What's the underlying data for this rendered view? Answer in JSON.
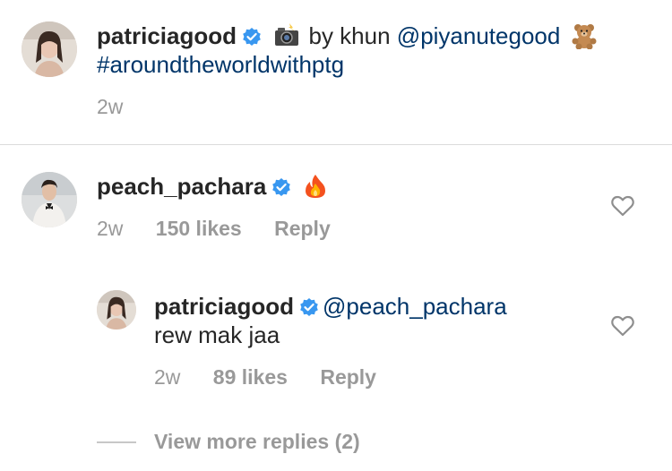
{
  "caption": {
    "username": "patriciagood",
    "camera_emoji": "camera-with-flash",
    "by_text": "by khun",
    "mention": "@piyanutegood",
    "bear_emoji": "teddy-bear",
    "hashtag": "#aroundtheworldwithptg",
    "time": "2w"
  },
  "comment": {
    "username": "peach_pachara",
    "emoji": "fire",
    "time": "2w",
    "likes": "150 likes",
    "reply_label": "Reply"
  },
  "reply": {
    "username": "patriciagood",
    "mention": "@peach_pachara",
    "text": "rew mak jaa",
    "time": "2w",
    "likes": "89 likes",
    "reply_label": "Reply"
  },
  "view_more": "View more replies (2)",
  "colors": {
    "text": "#262626",
    "link": "#003569",
    "meta": "#999999",
    "verified": "#3897f0",
    "divider": "#dbdbdb"
  }
}
